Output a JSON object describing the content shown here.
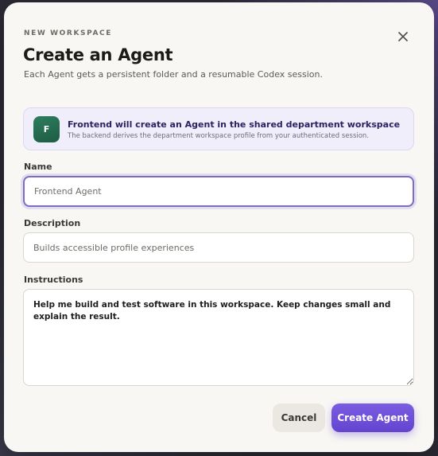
{
  "dialog": {
    "eyebrow": "NEW WORKSPACE",
    "title": "Create an Agent",
    "subtitle": "Each Agent gets a persistent folder and a resumable Codex session.",
    "close_icon": "close-icon"
  },
  "info_card": {
    "avatar_letter": "F",
    "heading": "Frontend will create an Agent in the shared department workspace",
    "text": "The backend derives the department workspace profile from your authenticated session."
  },
  "form": {
    "name": {
      "label": "Name",
      "value": "",
      "placeholder": "Frontend Agent"
    },
    "description": {
      "label": "Description",
      "value": "",
      "placeholder": "Builds accessible profile experiences"
    },
    "instructions": {
      "label": "Instructions",
      "value": "Help me build and test software in this workspace. Keep changes small and explain the result."
    }
  },
  "actions": {
    "cancel_label": "Cancel",
    "create_label": "Create Agent"
  },
  "colors": {
    "accent": "#6a4fd8",
    "avatar": "#236b50",
    "card_bg": "#f1eefc"
  }
}
